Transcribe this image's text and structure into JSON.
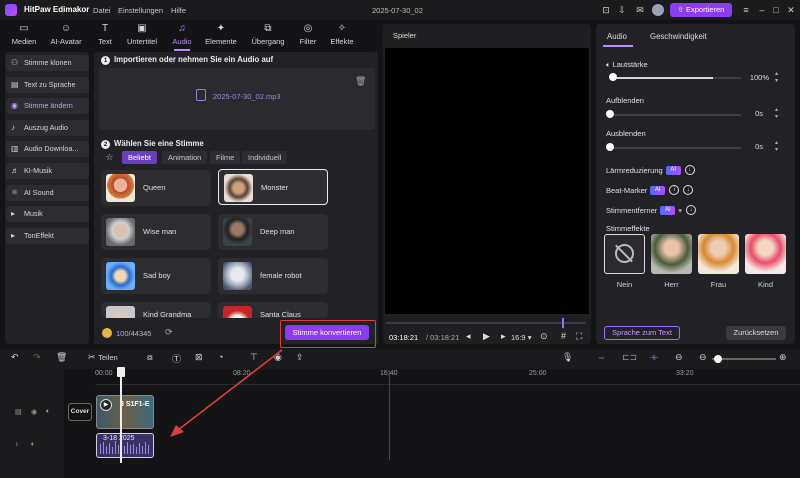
{
  "app": {
    "name": "HitPaw Edimakor",
    "window_title": "2025-07-30_02",
    "export_label": "Exportieren"
  },
  "menu": [
    "Datei",
    "Einstellungen",
    "Hilfe"
  ],
  "toolbar": [
    "Medien",
    "AI-Avatar",
    "Text",
    "Untertitel",
    "Audio",
    "Elemente",
    "Übergang",
    "Filter",
    "Effekte"
  ],
  "sidebar": [
    "Stimme klonen",
    "Text zu Sprache",
    "Stimme ändern",
    "Auszug Audio",
    "Audio Downloa...",
    "KI-Musik",
    "AI Sound",
    "Musik",
    "TonEffekt"
  ],
  "audio_panel": {
    "step1": "Importieren oder nehmen Sie ein Audio auf",
    "step1_num": "1",
    "file": "2025-07-30_02.mp3",
    "step2": "Wählen Sie eine Stimme",
    "step2_num": "2",
    "filters": [
      "Beliebt",
      "Animation",
      "Filme",
      "Individuell"
    ],
    "voices": [
      "Queen",
      "Monster",
      "Wise man",
      "Deep man",
      "Sad boy",
      "female robot",
      "Kind Grandma",
      "Santa Claus"
    ],
    "credits_used": "100",
    "credits_total": "/44345",
    "convert_label": "Stimme konvertieren"
  },
  "player": {
    "label": "Spieler",
    "time_current": "03:18:21",
    "time_total": "/ 03:18:21",
    "aspect": "16:9"
  },
  "right_panel": {
    "tabs": [
      "Audio",
      "Geschwindigkeit"
    ],
    "volume_label": "Lautstärke",
    "volume_value": "100%",
    "fade_in_label": "Aufblenden",
    "fade_in_value": "0s",
    "fade_out_label": "Ausblenden",
    "fade_out_value": "0s",
    "noise_label": "Lärmreduzierung",
    "beat_label": "Beat-Marker",
    "separator_label": "Stimmentferner",
    "ai_badge": "AI",
    "effects_label": "Stimmeffekte",
    "effects": [
      "Nein",
      "Herr",
      "Frau",
      "Kind"
    ],
    "speech_to_text": "Sprache zum Text",
    "reset": "Zurücksetzen"
  },
  "timeline": {
    "split_label": "Teilen",
    "ruler": [
      "00:00",
      "08:20",
      "16:40",
      "25:00",
      "33:20"
    ],
    "cover_label": "Cover",
    "video_clip_label": "3 S1F1-E",
    "audio_clip_label": "3-18 2025"
  },
  "colors": {
    "accent": "#8e3cf2",
    "highlight": "#e23b3b",
    "selected_text": "#c79bff"
  }
}
